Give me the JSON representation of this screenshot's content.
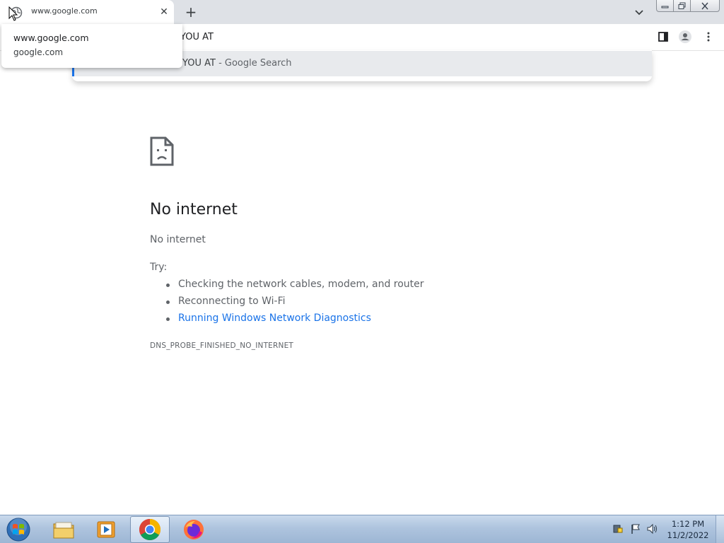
{
  "tab": {
    "title": "www.google.com",
    "close_glyph": "✕",
    "favicon": "globe-icon"
  },
  "new_tab_glyph": "+",
  "hover_card": {
    "title": "www.google.com",
    "domain": "google.com"
  },
  "omnibox": {
    "text": "YOU AT"
  },
  "suggestion": {
    "query": "YOU AT",
    "suffix": " - Google Search"
  },
  "error_page": {
    "heading": "No internet",
    "subheading": "No internet",
    "try_label": "Try:",
    "suggestions": [
      "Checking the network cables, modem, and router",
      "Reconnecting to Wi-Fi",
      "Running Windows Network Diagnostics"
    ],
    "error_code": "DNS_PROBE_FINISHED_NO_INTERNET"
  },
  "taskbar": {
    "apps": [
      "explorer-icon",
      "media-player-icon",
      "chrome-icon",
      "firefox-icon"
    ],
    "time": "1:12 PM",
    "date": "11/2/2022"
  },
  "colors": {
    "link": "#1a73e8",
    "text_secondary": "#5f6368",
    "tab_strip": "#dee1e6"
  }
}
